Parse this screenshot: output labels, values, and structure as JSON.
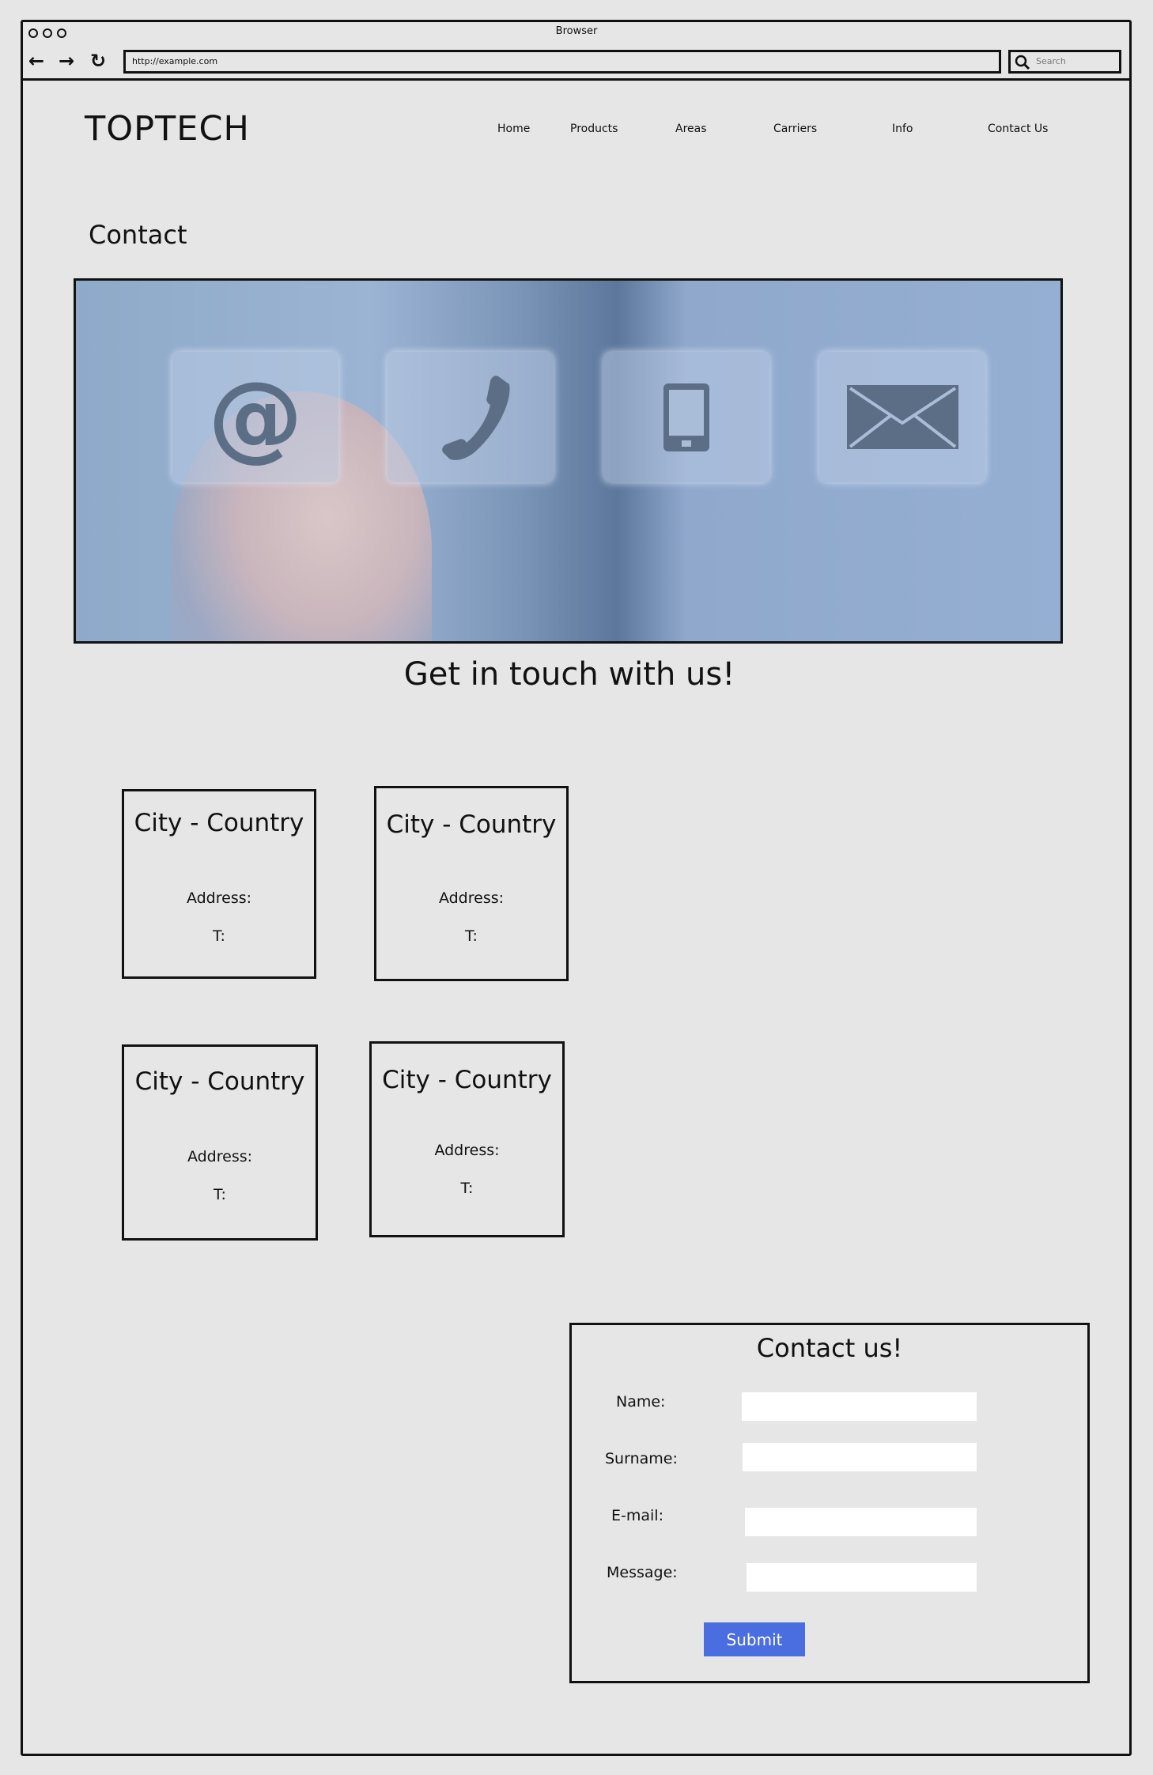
{
  "browser": {
    "title": "Browser",
    "url": "http://example.com",
    "search_placeholder": "Search"
  },
  "header": {
    "logo": "TOPTECH",
    "nav": [
      "Home",
      "Products",
      "Areas",
      "Carriers",
      "Info",
      "Contact Us"
    ]
  },
  "page": {
    "title": "Contact",
    "heading": "Get in touch with us!"
  },
  "offices": [
    {
      "city": "City - Country",
      "address_label": "Address:",
      "phone_label": "T:"
    },
    {
      "city": "City - Country",
      "address_label": "Address:",
      "phone_label": "T:"
    },
    {
      "city": "City - Country",
      "address_label": "Address:",
      "phone_label": "T:"
    },
    {
      "city": "City - Country",
      "address_label": "Address:",
      "phone_label": "T:"
    }
  ],
  "contact_form": {
    "title": "Contact us!",
    "name_label": "Name:",
    "surname_label": "Surname:",
    "email_label": "E-mail:",
    "message_label": "Message:",
    "submit_label": "Submit",
    "submit_color": "#4a6ee0"
  }
}
